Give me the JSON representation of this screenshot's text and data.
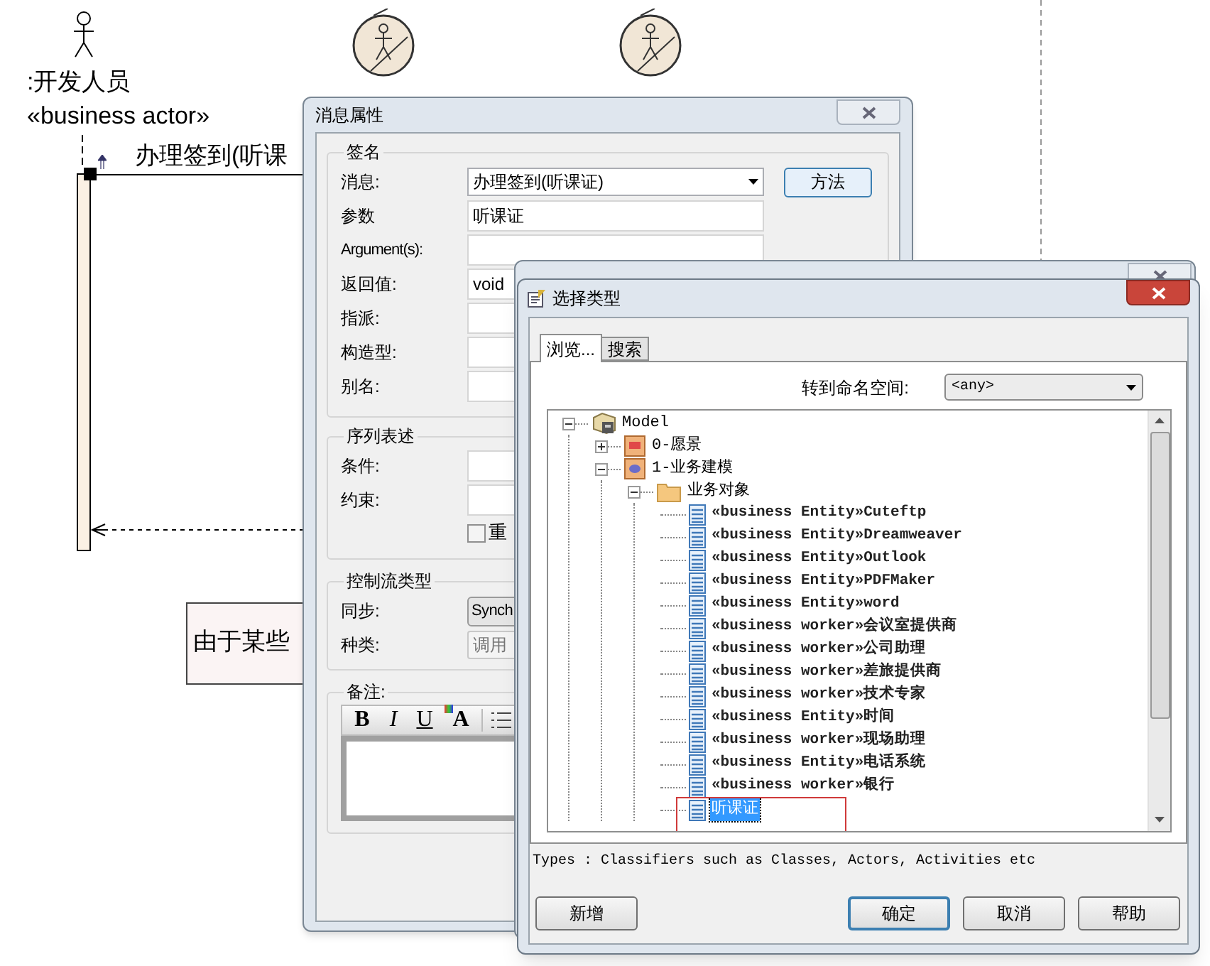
{
  "diagram": {
    "actor_name": ":开发人员",
    "actor_stereotype": "«business actor»",
    "message": "办理签到(听课",
    "note": "由于某些"
  },
  "message_dialog": {
    "title": "消息属性",
    "signature": {
      "legend": "签名",
      "method_button": "方法",
      "fields": [
        {
          "label": "消息:",
          "kind": "dropdown",
          "value": "办理签到(听课证)"
        },
        {
          "label": "参数",
          "kind": "text",
          "value": "听课证"
        },
        {
          "label": "Argument(s):",
          "kind": "text"
        },
        {
          "label": "返回值:",
          "kind": "text",
          "value": "void"
        },
        {
          "label": "指派:",
          "kind": "text"
        },
        {
          "label": "构造型:",
          "kind": "text"
        },
        {
          "label": "别名:",
          "kind": "text"
        }
      ]
    },
    "sequence": {
      "legend": "序列表述",
      "fields": [
        {
          "label": "条件:",
          "kind": "text"
        },
        {
          "label": "约束:",
          "kind": "text"
        }
      ],
      "checkbox": {
        "label": "重",
        "checked": false
      }
    },
    "control_flow": {
      "legend": "控制流类型",
      "fields": [
        {
          "label": "同步:",
          "kind": "combo",
          "value": "Synch"
        },
        {
          "label": "种类:",
          "kind": "disabled",
          "value": "调用"
        }
      ]
    },
    "notes": {
      "legend": "备注:",
      "toolbar": [
        {
          "kind": "bold",
          "label": "B"
        },
        {
          "kind": "italic",
          "label": "I"
        },
        {
          "kind": "underline",
          "label": "U"
        },
        {
          "kind": "color",
          "label": "A"
        },
        {
          "kind": "list"
        }
      ]
    }
  },
  "type_dialog": {
    "title": "选择类型",
    "tabs": [
      {
        "label": "浏览...",
        "selected": true
      },
      {
        "label": "搜索",
        "selected": false
      }
    ],
    "namespace_label": "转到命名空间:",
    "namespace_value": "<any>",
    "tree": [
      {
        "label": "Model",
        "kind": "model",
        "expanded": true,
        "selected": false,
        "children": [
          {
            "label": "0-愿景",
            "kind": "package",
            "expanded": false,
            "selected": false
          },
          {
            "label": "1-业务建模",
            "kind": "diagram-package",
            "expanded": true,
            "selected": false,
            "children": [
              {
                "label": "业务对象",
                "kind": "folder",
                "expanded": true,
                "selected": false,
                "children": [
                  {
                    "label": "«business Entity»Cuteftp",
                    "kind": "class",
                    "selected": false,
                    "highlighted": false
                  },
                  {
                    "label": "«business Entity»Dreamweaver",
                    "kind": "class",
                    "selected": false,
                    "highlighted": false
                  },
                  {
                    "label": "«business Entity»Outlook",
                    "kind": "class",
                    "selected": false,
                    "highlighted": false
                  },
                  {
                    "label": "«business Entity»PDFMaker",
                    "kind": "class",
                    "selected": false,
                    "highlighted": false
                  },
                  {
                    "label": "«business Entity»word",
                    "kind": "class",
                    "selected": false,
                    "highlighted": false
                  },
                  {
                    "label": "«business worker»会议室提供商",
                    "kind": "class",
                    "selected": false,
                    "highlighted": false
                  },
                  {
                    "label": "«business worker»公司助理",
                    "kind": "class",
                    "selected": false,
                    "highlighted": false
                  },
                  {
                    "label": "«business worker»差旅提供商",
                    "kind": "class",
                    "selected": false,
                    "highlighted": false
                  },
                  {
                    "label": "«business worker»技术专家",
                    "kind": "class",
                    "selected": false,
                    "highlighted": false
                  },
                  {
                    "label": "«business Entity»时间",
                    "kind": "class",
                    "selected": false,
                    "highlighted": false
                  },
                  {
                    "label": "«business worker»现场助理",
                    "kind": "class",
                    "selected": false,
                    "highlighted": false
                  },
                  {
                    "label": "«business Entity»电话系统",
                    "kind": "class",
                    "selected": false,
                    "highlighted": false
                  },
                  {
                    "label": "«business worker»银行",
                    "kind": "class",
                    "selected": false,
                    "highlighted": false
                  },
                  {
                    "label": "听课证",
                    "kind": "class",
                    "selected": true,
                    "highlighted": true
                  }
                ]
              }
            ]
          }
        ]
      }
    ],
    "status": "Types : Classifiers such as Classes, Actors, Activities etc",
    "buttons": [
      {
        "label": "新增",
        "default": false
      },
      {
        "label": "确定",
        "default": true
      },
      {
        "label": "取消",
        "default": false
      },
      {
        "label": "帮助",
        "default": false
      }
    ]
  }
}
